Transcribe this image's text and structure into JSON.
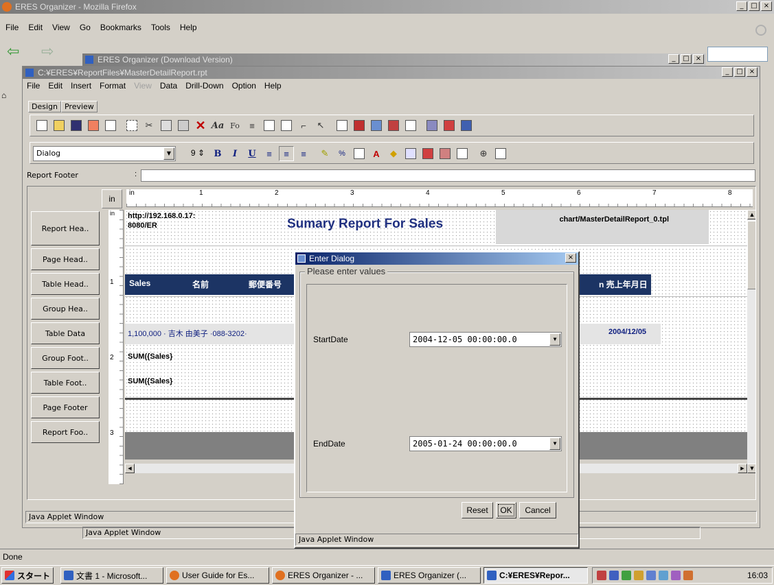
{
  "firefox": {
    "title": "ERES Organizer - Mozilla Firefox",
    "menu": [
      "File",
      "Edit",
      "View",
      "Go",
      "Bookmarks",
      "Tools",
      "Help"
    ],
    "status": "Done"
  },
  "inner_window": {
    "title": "ERES Organizer (Download Version)"
  },
  "report_window": {
    "title": "C:¥ERES¥ReportFiles¥MasterDetailReport.rpt",
    "menu": [
      "File",
      "Edit",
      "Insert",
      "Format",
      "View",
      "Data",
      "Drill-Down",
      "Option",
      "Help"
    ],
    "tabs": [
      "Design",
      "Preview"
    ],
    "font_name": "Dialog",
    "font_size": "9",
    "section_label": "Report Footer",
    "ruler_unit": "in",
    "ruler_numbers": [
      "1",
      "2",
      "3",
      "4",
      "5",
      "6",
      "7",
      "8"
    ],
    "vruler_numbers": [
      "1",
      "2",
      "3"
    ],
    "bands": [
      "Report Hea..",
      "Page Head..",
      "Table Head..",
      "Group Hea..",
      "Table Data",
      "Group Foot..",
      "Table Foot..",
      "Page Footer",
      "Report Foo.."
    ],
    "url_cell": "http://192.168.0.17:8080/ER",
    "report_title": "Sumary Report For Sales",
    "chart_cell": "chart/MasterDetailReport_0.tpl",
    "table_headers": [
      "Sales",
      "名前",
      "郵便番号"
    ],
    "table_header_right": "n 売上年月日",
    "table_data": "1,100,000 · 吉木 由美子 ·088-3202·",
    "table_data_date": "2004/12/05",
    "sum_group": "SUM({Sales}",
    "sum_table": "SUM({Sales}",
    "status": "Java Applet Window",
    "status2": "Java Applet Window"
  },
  "dialog": {
    "title": "Enter Dialog",
    "group_label": "Please enter values",
    "start_label": "StartDate",
    "start_value": "2004-12-05 00:00:00.0",
    "end_label": "EndDate",
    "end_value": "2005-01-24 00:00:00.0",
    "reset": "Reset",
    "ok": "OK",
    "cancel": "Cancel",
    "status": "Java Applet Window"
  },
  "taskbar": {
    "start": "スタート",
    "items": [
      "文書 1 - Microsoft...",
      "User Guide for Es...",
      "ERES Organizer - ...",
      "ERES Organizer (...",
      "C:¥ERES¥Repor..."
    ],
    "clock": "16:03"
  }
}
